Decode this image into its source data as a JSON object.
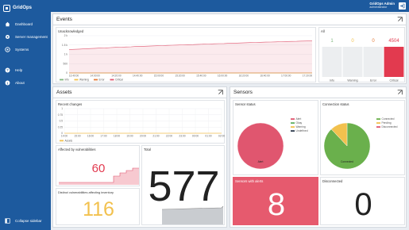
{
  "app": {
    "name": "GridOps"
  },
  "sidebar": {
    "items": [
      {
        "label": "Dashboard",
        "icon": "home-icon"
      },
      {
        "label": "Server management",
        "icon": "gear-icon"
      },
      {
        "label": "Systems",
        "icon": "systems-icon"
      },
      {
        "label": "Help",
        "icon": "help-icon"
      },
      {
        "label": "About",
        "icon": "info-icon"
      }
    ],
    "collapse_label": "Collapse sidebar"
  },
  "user": {
    "name": "GridOps Admin",
    "role": "administrator"
  },
  "events": {
    "title": "Events",
    "chart_title": "Unacknowledged",
    "all_title": "All",
    "chart_data": [
      {
        "type": "line",
        "title": "Unacknowledged",
        "x": [
          "13:40:00",
          "13:45:00",
          "13:50:00",
          "13:55:00",
          "14:00:00",
          "14:05:00",
          "14:10:00",
          "14:15:00",
          "14:20:00",
          "14:25:00",
          "14:30:00",
          "14:35:00",
          "14:40:00",
          "14:45:00",
          "14:50:00",
          "14:55:00",
          "15:00:00",
          "15:05:00",
          "15:10:00",
          "15:15:00",
          "15:20:00",
          "15:25:00",
          "15:30:00",
          "15:35:00",
          "15:40:00",
          "15:45:00",
          "15:50:00",
          "15:55:00",
          "16:00:00",
          "16:05:00",
          "16:10:00",
          "16:15:00",
          "16:20:00",
          "16:25:00",
          "16:30:00",
          "16:35:00",
          "16:40:00",
          "16:45:00",
          "16:50:00",
          "16:55:00",
          "17:00:00",
          "17:05:00",
          "17:10:00",
          "17:15:00",
          "17:20:00",
          "17:25:00",
          "17:30:00",
          "17:35:00"
        ],
        "x_tick_labels": [
          "13:40:00",
          "14:00:00",
          "14:20:00",
          "14:40:00",
          "15:00:00",
          "15:20:00",
          "15:40:00",
          "16:00:00",
          "16:20:00",
          "16:40:00",
          "17:00:00",
          "17:20:00"
        ],
        "y_tick_labels": [
          "2 k",
          "1.5 k",
          "1 k",
          "500",
          "0"
        ],
        "ylim": [
          0,
          2000
        ],
        "series": [
          {
            "name": "Info",
            "color": "#7fb77e",
            "values": [
              0,
              0,
              0,
              0,
              0,
              0,
              0,
              0,
              0,
              0,
              0,
              0,
              0,
              0,
              0,
              0,
              0,
              0,
              0,
              0,
              0,
              0,
              0,
              0,
              0,
              0,
              0,
              0,
              0,
              0,
              0,
              0,
              0,
              0,
              0,
              0,
              0,
              0,
              0,
              0,
              0,
              0,
              0,
              0,
              0,
              0,
              0,
              0
            ]
          },
          {
            "name": "Warning",
            "color": "#f2c14e",
            "values": [
              0,
              0,
              0,
              0,
              0,
              0,
              0,
              0,
              0,
              0,
              0,
              0,
              0,
              0,
              0,
              0,
              0,
              0,
              0,
              0,
              0,
              0,
              0,
              0,
              0,
              0,
              0,
              0,
              0,
              0,
              0,
              0,
              0,
              0,
              0,
              0,
              0,
              0,
              0,
              0,
              0,
              0,
              0,
              0,
              0,
              0,
              0,
              0
            ]
          },
          {
            "name": "Error",
            "color": "#e47b39",
            "values": [
              0,
              0,
              0,
              0,
              0,
              0,
              0,
              0,
              0,
              0,
              0,
              0,
              0,
              0,
              0,
              0,
              0,
              0,
              0,
              0,
              0,
              0,
              0,
              0,
              0,
              0,
              0,
              0,
              0,
              0,
              0,
              0,
              0,
              0,
              0,
              0,
              0,
              0,
              0,
              0,
              0,
              0,
              0,
              0,
              0,
              0,
              0,
              0
            ]
          },
          {
            "name": "Critical",
            "color": "#e0566f",
            "values": [
              1260,
              1270,
              1280,
              1295,
              1310,
              1325,
              1335,
              1345,
              1360,
              1375,
              1385,
              1395,
              1405,
              1420,
              1430,
              1440,
              1450,
              1460,
              1470,
              1480,
              1490,
              1500,
              1510,
              1520,
              1525,
              1535,
              1545,
              1555,
              1565,
              1575,
              1580,
              1590,
              1600,
              1610,
              1620,
              1630,
              1640,
              1645,
              1655,
              1660,
              1670,
              1680,
              1690,
              1695,
              1700,
              1710,
              1715,
              1720
            ]
          }
        ]
      },
      {
        "type": "bar",
        "title": "All",
        "categories": [
          "Info",
          "Warning",
          "Error",
          "Critical"
        ],
        "values": [
          1,
          0,
          0,
          4504
        ],
        "value_labels": [
          "1",
          "0",
          "0",
          "4504"
        ],
        "colors": [
          "#7fb77e",
          "#f2c14e",
          "#e47b39",
          "#e23a4f"
        ]
      }
    ]
  },
  "assets": {
    "title": "Assets",
    "recent_title": "Recent changes",
    "recent_chart": {
      "type": "line",
      "title": "Recent changes",
      "x_tick_labels": [
        "14:00",
        "15:00",
        "16:00",
        "17:00",
        "18:00",
        "19:00",
        "20:00",
        "21:00",
        "22:00",
        "23:00",
        "00:00",
        "01:00",
        "02:00"
      ],
      "y_tick_labels": [
        "1",
        "0.75",
        "0.5",
        "0.25",
        "0"
      ],
      "ylim": [
        0,
        1
      ],
      "series": [
        {
          "name": "Assets",
          "color": "#f2c14e",
          "values": [
            0,
            0,
            0,
            0,
            0,
            0,
            0,
            0,
            0,
            0,
            0,
            0,
            0
          ]
        }
      ]
    },
    "vuln_title": "Affected by vulnerabilities",
    "vuln_value": "60",
    "total_title": "Total",
    "total_value": "577",
    "distinct_title": "Distinct vulnerabilities affecting inventory",
    "distinct_value": "116"
  },
  "sensors": {
    "title": "Sensors",
    "status_title": "Sensor status",
    "status_chart": {
      "type": "pie",
      "title": "Sensor status",
      "categories": [
        "Alert",
        "Okay",
        "Warning",
        "Undefined"
      ],
      "values": [
        8,
        0,
        0,
        0
      ],
      "slice_labels": [
        "Alert"
      ],
      "colors": [
        "#e0566f",
        "#5fae5f",
        "#f2c14e",
        "#2e3b4e"
      ]
    },
    "conn_title": "Connection status",
    "conn_chart": {
      "type": "pie",
      "title": "Connection status",
      "categories": [
        "Connected",
        "Pending",
        "Disconnected"
      ],
      "values": [
        88,
        12,
        0
      ],
      "slice_labels": [
        "Connected"
      ],
      "colors": [
        "#6ab04c",
        "#f2c14e",
        "#e0566f"
      ]
    },
    "alerts_title": "Sensors with alerts",
    "alerts_value": "8",
    "disc_title": "Disconnected",
    "disc_value": "0"
  }
}
